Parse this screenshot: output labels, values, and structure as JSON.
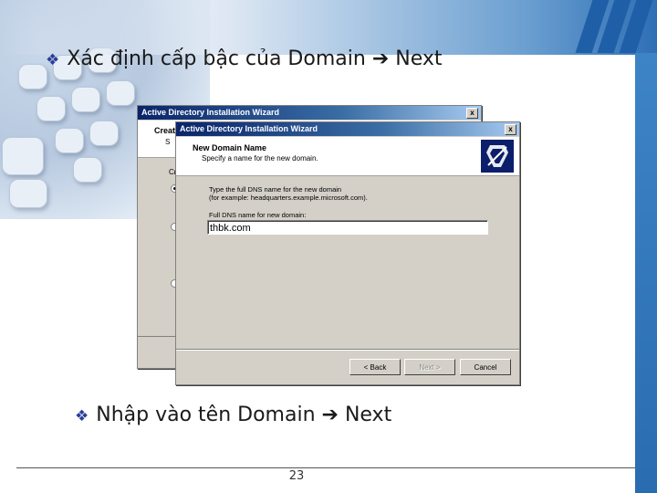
{
  "slide": {
    "title_top": "Xác định cấp bậc của Domain",
    "title_top_next": "Next",
    "title_bottom": "Nhập vào tên Domain",
    "title_bottom_next": "Next",
    "bullet_glyph": "❖",
    "arrow_glyph": "➔",
    "page_number": "23"
  },
  "back_dialog": {
    "window_title": "Active Directory Installation Wizard",
    "header_title": "Creat",
    "header_sub": "S",
    "label": "Cr",
    "close_glyph": "x"
  },
  "front_dialog": {
    "window_title": "Active Directory Installation Wizard",
    "close_glyph": "x",
    "header_title": "New Domain Name",
    "header_subtitle": "Specify a name for the new domain.",
    "desc_line1": "Type the full DNS name for the new domain",
    "desc_line2": "(for example: headquarters.example.microsoft.com).",
    "field_label": "Full DNS name for new domain:",
    "dns_value": "thbk.com",
    "buttons": {
      "back": "< Back",
      "next": "Next >",
      "cancel": "Cancel"
    }
  },
  "colors": {
    "accent_blue": "#2a6cb0",
    "titlebar_blue": "#0a246a",
    "dialog_gray": "#d4d0c8"
  }
}
